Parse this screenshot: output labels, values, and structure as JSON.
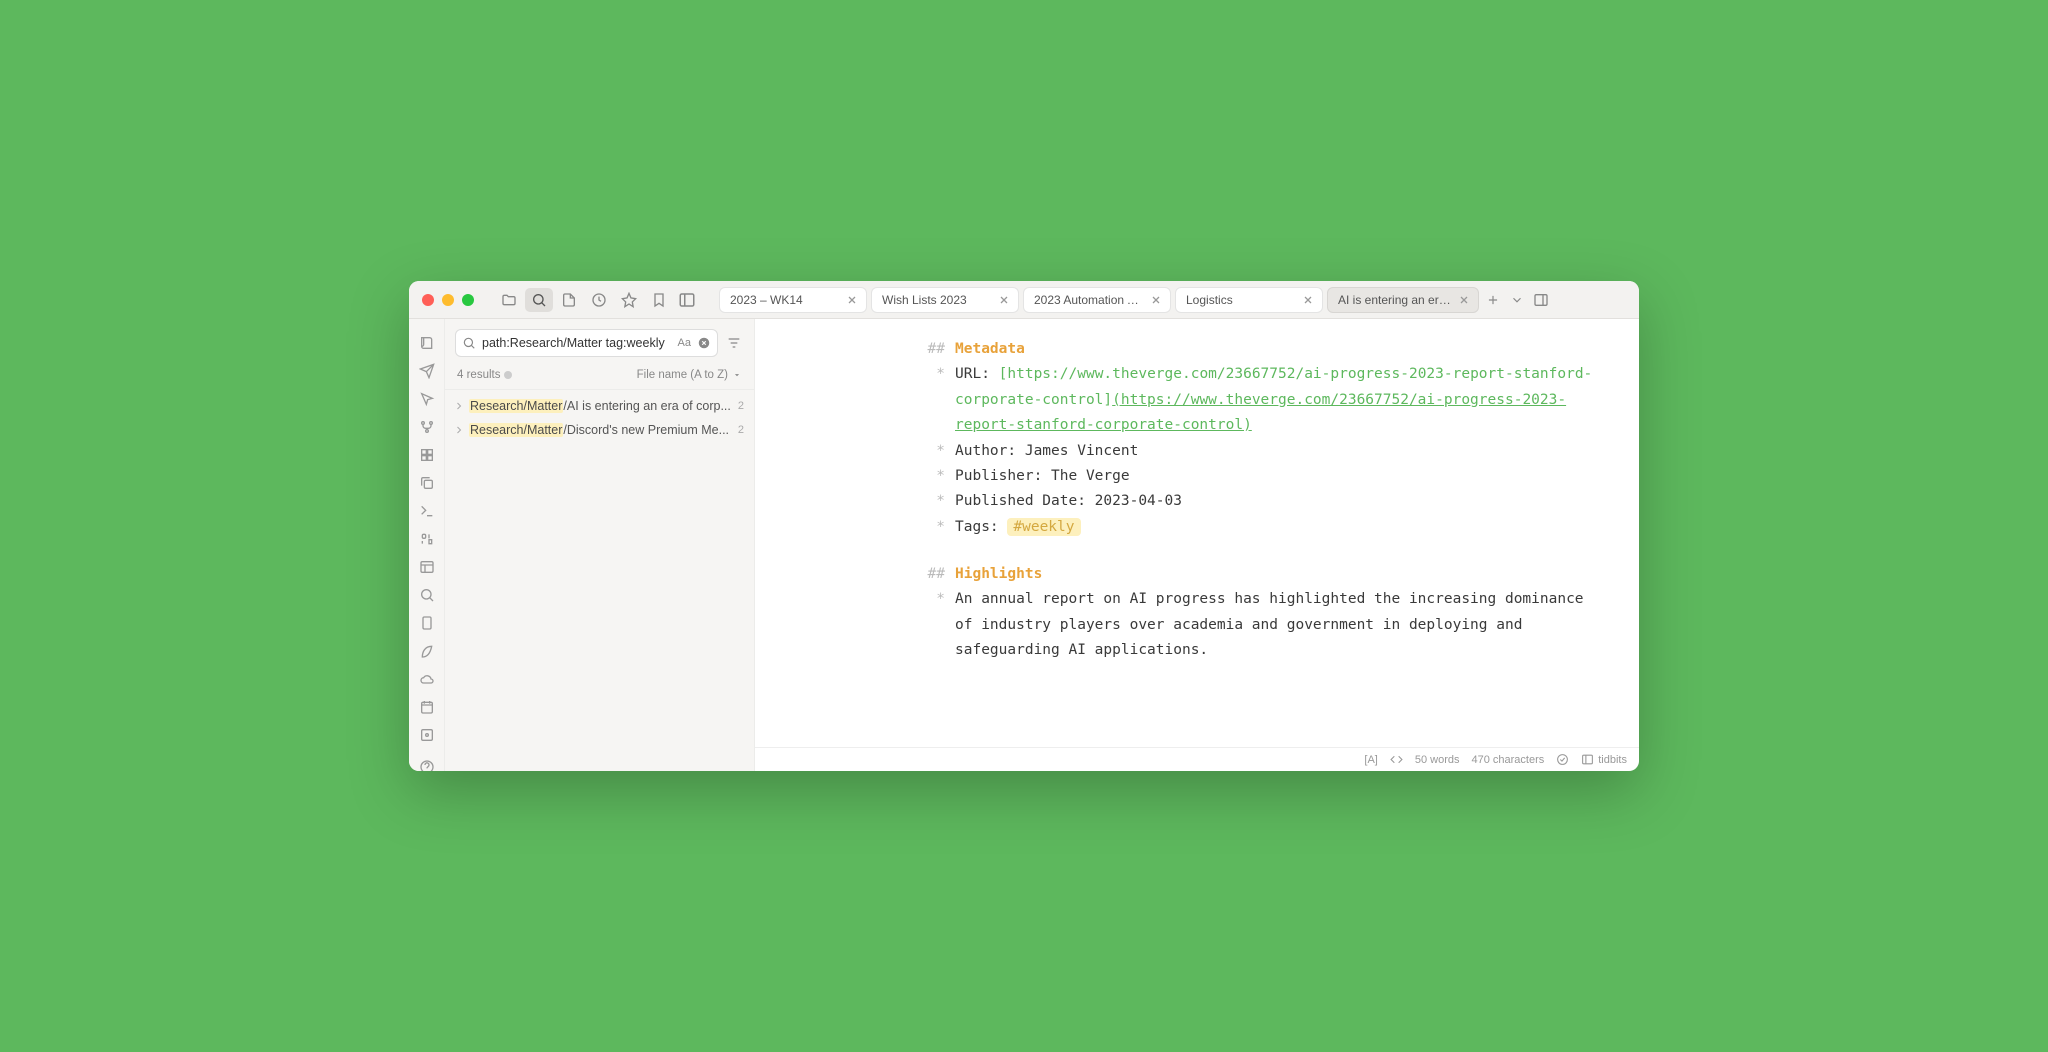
{
  "tabs": [
    {
      "label": "2023 – WK14"
    },
    {
      "label": "Wish Lists 2023"
    },
    {
      "label": "2023 Automation Ap..."
    },
    {
      "label": "Logistics"
    },
    {
      "label": "AI is entering an era o...",
      "active": true
    }
  ],
  "search": {
    "query": "path:Research/Matter tag:weekly",
    "match_case": "Aa",
    "results_label": "4 results",
    "sort_label": "File name (A to Z)"
  },
  "results": [
    {
      "path": "Research/Matter",
      "title": "/AI is entering an era of corp...",
      "count": "2"
    },
    {
      "path": "Research/Matter",
      "title": "/Discord's new Premium Me...",
      "count": "2"
    }
  ],
  "doc": {
    "h_metadata": "Metadata",
    "url_label": "URL: ",
    "url_text": "https://www.theverge.com/23667752/ai-progress-2023-report-stanford-corporate-control",
    "url_link": "(https://www.theverge.com/23667752/ai-progress-2023-report-stanford-corporate-control)",
    "author": "Author: James Vincent",
    "publisher": "Publisher: The Verge",
    "published": "Published Date: 2023-04-03",
    "tags_label": "Tags: ",
    "tag": "#weekly",
    "h_highlights": "Highlights",
    "highlight1": "An annual report on AI progress has highlighted the increasing dominance of industry players over academia and government in deploying and safeguarding AI applications."
  },
  "status": {
    "mode": "[A]",
    "words": "50 words",
    "chars": "470 characters",
    "space": "tidbits"
  }
}
